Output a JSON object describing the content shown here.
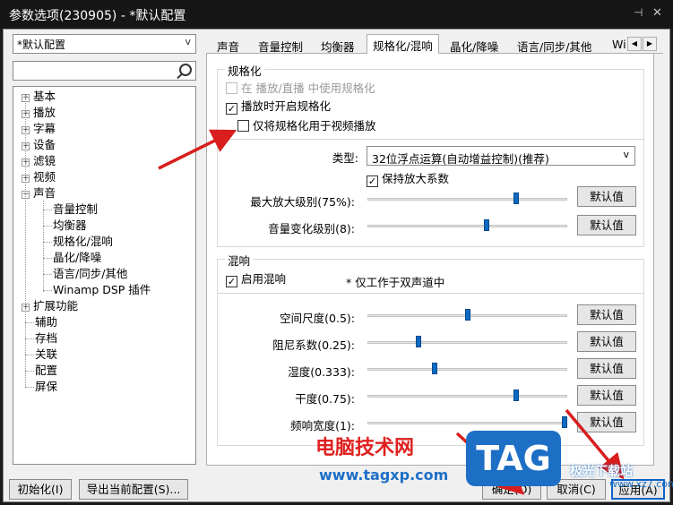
{
  "window": {
    "title": "参数选项(230905) - *默认配置",
    "controls": [
      "✕",
      "◻",
      "✕"
    ]
  },
  "profile": {
    "selected": "*默认配置",
    "arrow": "v"
  },
  "search": {
    "placeholder": "",
    "value": ""
  },
  "tree": [
    {
      "label": "基本",
      "expandable": true
    },
    {
      "label": "播放",
      "expandable": true
    },
    {
      "label": "字幕",
      "expandable": true
    },
    {
      "label": "设备",
      "expandable": true
    },
    {
      "label": "滤镜",
      "expandable": true
    },
    {
      "label": "视频",
      "expandable": true
    },
    {
      "label": "声音",
      "expanded": true
    },
    {
      "label": "音量控制",
      "child": true
    },
    {
      "label": "均衡器",
      "child": true
    },
    {
      "label": "规格化/混响",
      "child": true
    },
    {
      "label": "晶化/降噪",
      "child": true
    },
    {
      "label": "语言/同步/其他",
      "child": true
    },
    {
      "label": "Winamp DSP 插件",
      "child": true
    },
    {
      "label": "扩展功能",
      "expandable": true
    },
    {
      "label": "辅助"
    },
    {
      "label": "存档"
    },
    {
      "label": "关联"
    },
    {
      "label": "配置"
    },
    {
      "label": "屏保"
    }
  ],
  "tabs": [
    "声音",
    "音量控制",
    "均衡器",
    "规格化/混响",
    "晶化/降噪",
    "语言/同步/其他",
    "Wi"
  ],
  "tab_scroll": [
    "◀",
    "▶"
  ],
  "normalize": {
    "group_title": "规格化",
    "use_in_stream": {
      "label": "在 播放/直播 中使用规格化",
      "checked": false,
      "disabled": true
    },
    "enable_on_play": {
      "label": "播放时开启规格化",
      "checked": true
    },
    "video_only": {
      "label": "仅将规格化用于视频播放",
      "checked": false
    },
    "type_label": "类型:",
    "type_value": "32位浮点运算(自动增益控制)(推荐)",
    "keep_gain": {
      "label": "保持放大系数",
      "checked": true
    },
    "max_gain": {
      "label": "最大放大级别(75%):",
      "value": 0.75
    },
    "vol_change": {
      "label": "音量变化级别(8):",
      "value": 0.6
    }
  },
  "reverb": {
    "group_title": "混响",
    "enable": {
      "label": "启用混响",
      "checked": true
    },
    "note": "* 仅工作于双声道中",
    "sliders": [
      {
        "label": "空间尺度(0.5):",
        "value": 0.5
      },
      {
        "label": "阻尼系数(0.25):",
        "value": 0.25
      },
      {
        "label": "湿度(0.333):",
        "value": 0.333
      },
      {
        "label": "干度(0.75):",
        "value": 0.75
      },
      {
        "label": "频响宽度(1):",
        "value": 1.0
      }
    ]
  },
  "default_label": "默认值",
  "checkmark": "✓",
  "footer": {
    "init": "初始化(I)",
    "export": "导出当前配置(S)...",
    "ok": "确定(O)",
    "cancel": "取消(C)",
    "apply": "应用(A)"
  },
  "watermark": {
    "brand": "电脑技术网",
    "url": "www.tagxp.com",
    "logo": "TAG",
    "site": "极光下载站",
    "site_url": "www.xz7.com"
  },
  "colors": {
    "slider_thumb": "#0b6ac4",
    "arrow": "#d81e1e",
    "logo_bg": "#1d6fc6",
    "brand_red": "#e02020"
  }
}
